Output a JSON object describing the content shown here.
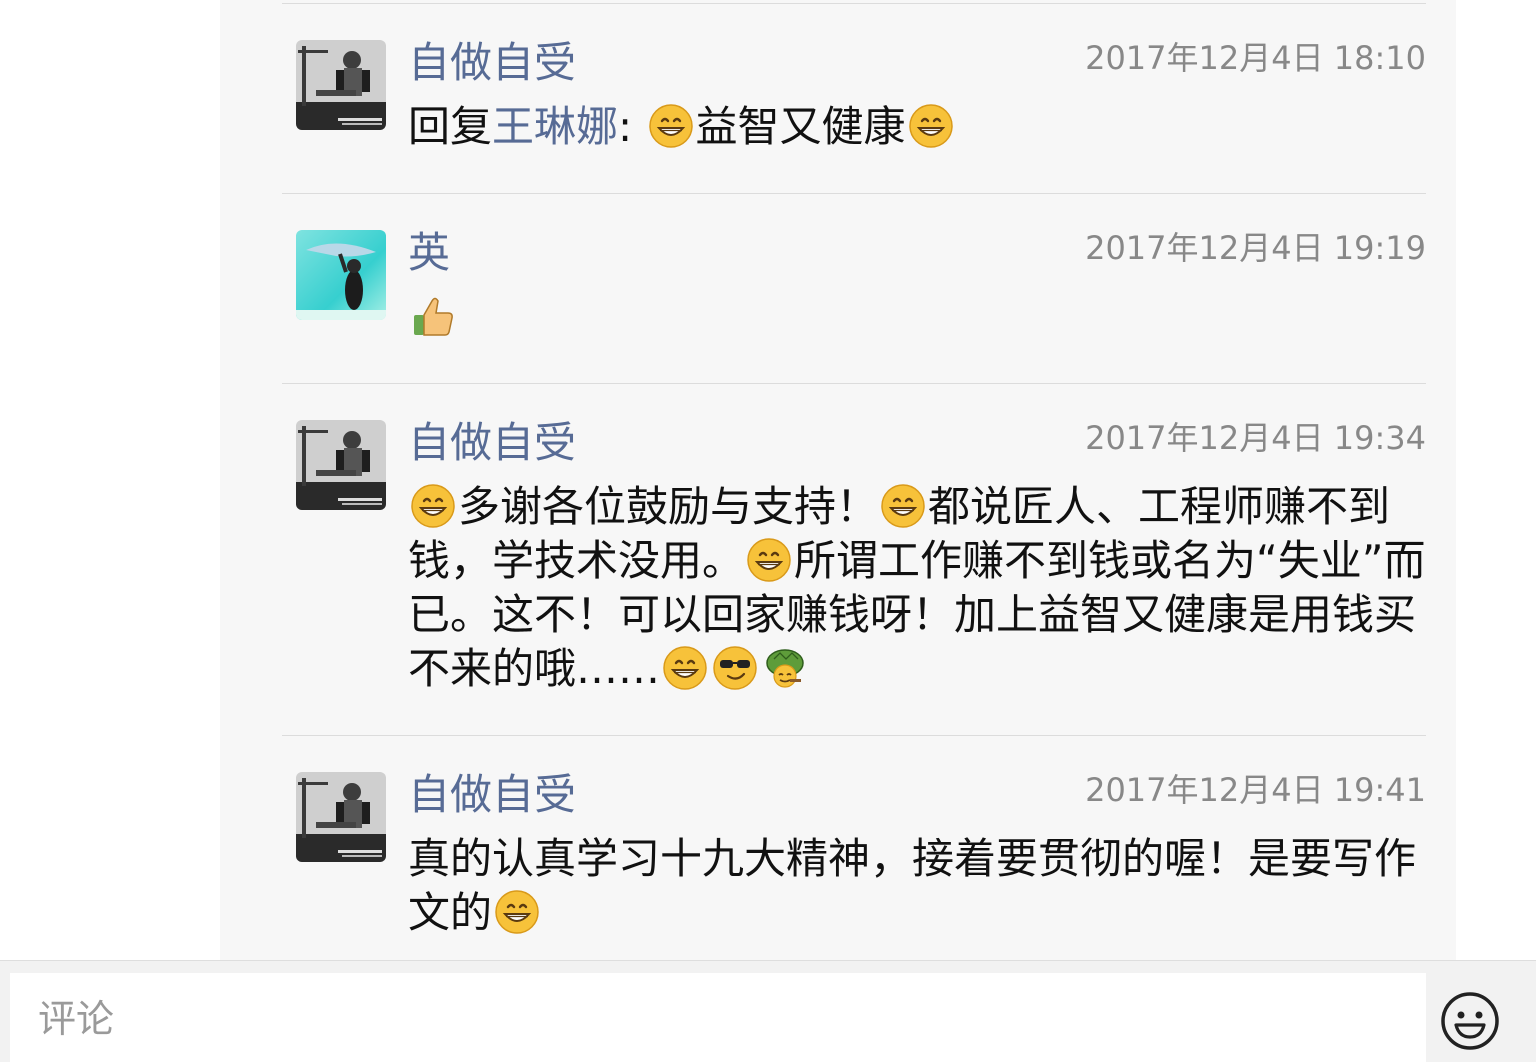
{
  "comments": [
    {
      "author": "自做自受",
      "time": "2017年12月4日 18:10",
      "reply_prefix": "回复",
      "reply_target": "王琳娜",
      "reply_colon": ": ",
      "text_1": "益智又健康",
      "avatar": "camera-operator-photo"
    },
    {
      "author": "英",
      "time": "2017年12月4日 19:19",
      "text_1": "",
      "avatar": "dolphin-photo"
    },
    {
      "author": "自做自受",
      "time": "2017年12月4日 19:34",
      "text_1": "多谢各位鼓励与支持！",
      "text_2": "都说匠人、工程师赚不到钱，学技术没用。",
      "text_3": "所谓工作赚不到钱或名为“失业”而已。这不！可以回家赚钱呀！加上益智又健康是用钱买不来的哦……",
      "avatar": "camera-operator-photo"
    },
    {
      "author": "自做自受",
      "time": "2017年12月4日 19:41",
      "text_1": "真的认真学习十九大精神，接着要贯彻的喔！是要写作文的",
      "avatar": "camera-operator-photo"
    }
  ],
  "comment_bar": {
    "placeholder": "评论",
    "emoji_button_icon": "smiley-face-icon"
  },
  "colors": {
    "author": "#576b95",
    "timestamp": "#888888",
    "panel_bg": "#f7f7f7"
  }
}
